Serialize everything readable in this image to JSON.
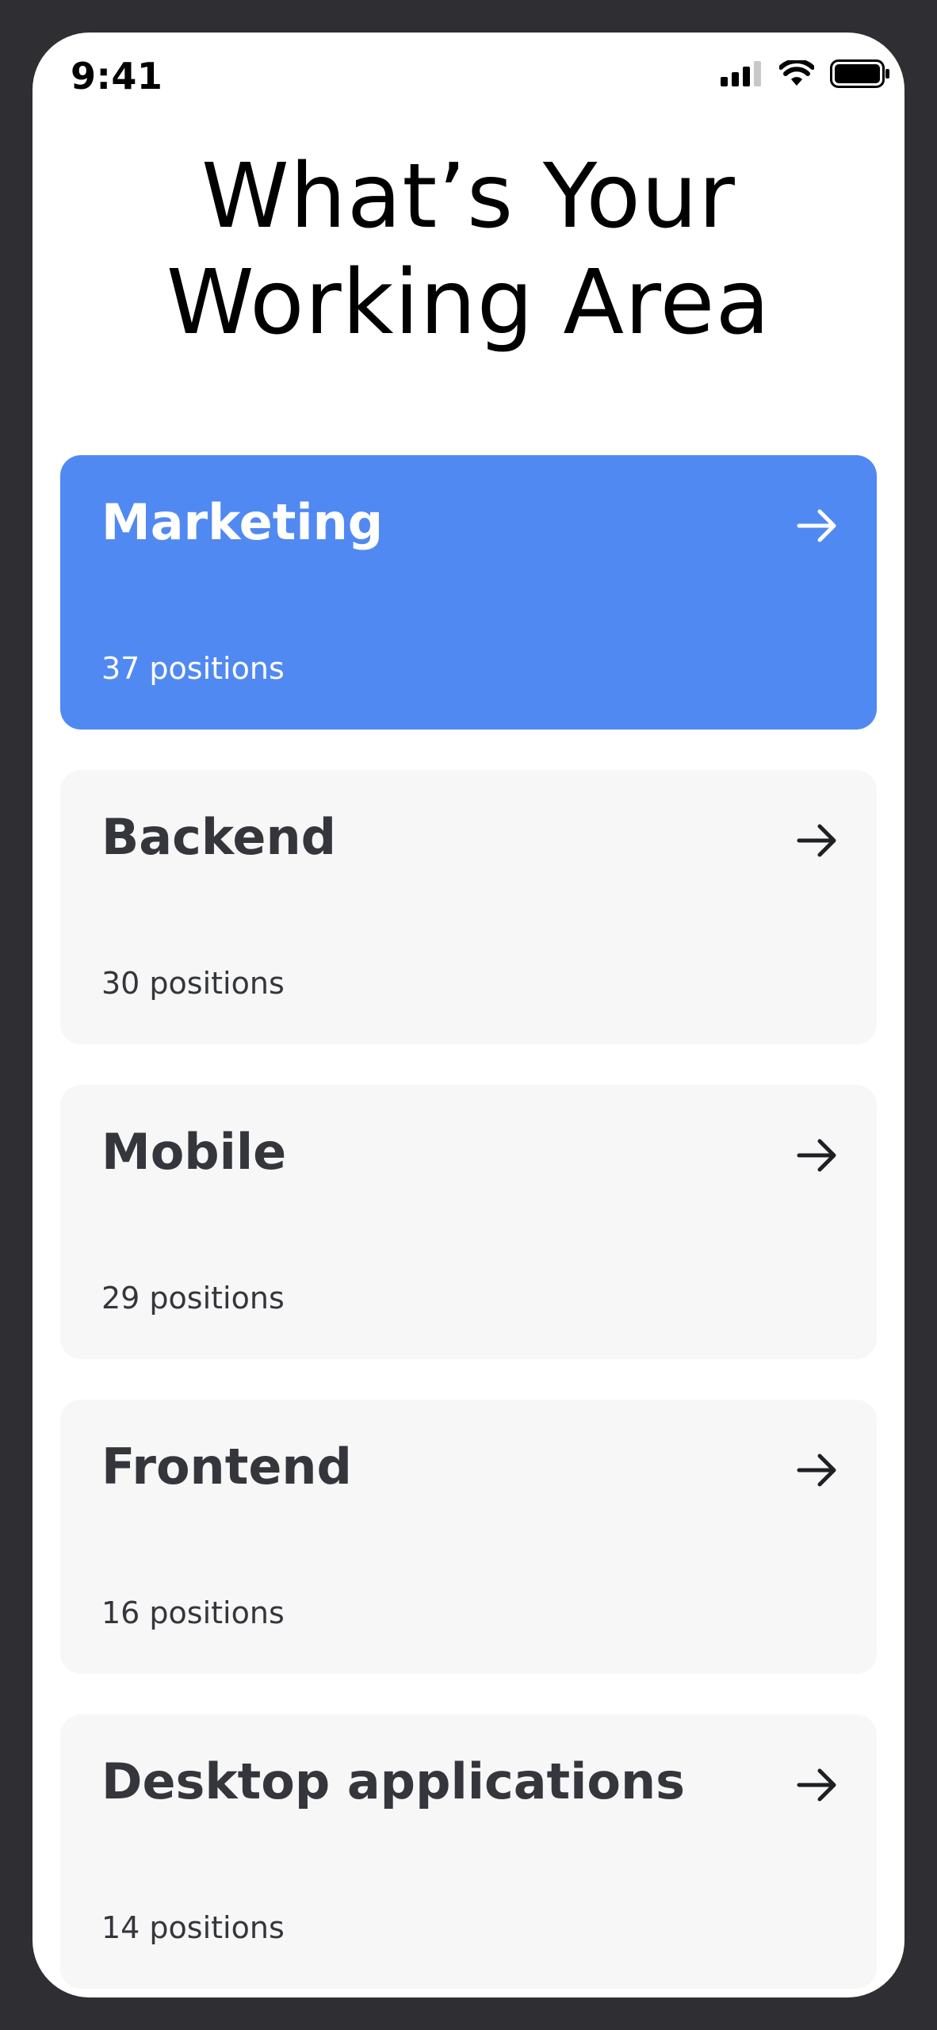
{
  "status_bar": {
    "time": "9:41",
    "icons": [
      "cellular-signal-icon",
      "wifi-icon",
      "battery-icon"
    ]
  },
  "title": {
    "line1": "What’s Your",
    "line2": "Working Area"
  },
  "colors": {
    "accent": "#5189f2",
    "card_bg": "#f7f7f7",
    "text_dark": "#34363c"
  },
  "areas": [
    {
      "name": "Marketing",
      "count": "37 positions",
      "selected": true,
      "icon": "arrow-right-icon"
    },
    {
      "name": "Backend",
      "count": "30 positions",
      "selected": false,
      "icon": "arrow-right-icon"
    },
    {
      "name": "Mobile",
      "count": "29 positions",
      "selected": false,
      "icon": "arrow-right-icon"
    },
    {
      "name": "Frontend",
      "count": "16 positions",
      "selected": false,
      "icon": "arrow-right-icon"
    },
    {
      "name": "Desktop applications",
      "count": "14 positions",
      "selected": false,
      "icon": "arrow-right-icon"
    }
  ]
}
